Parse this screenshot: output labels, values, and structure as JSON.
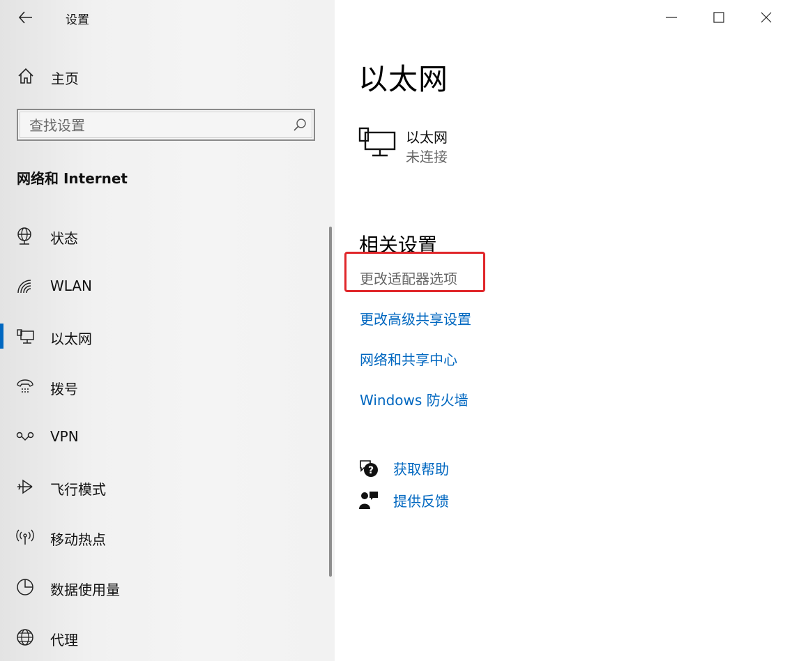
{
  "window": {
    "title": "设置",
    "controls": {
      "minimize": "minimize-icon",
      "maximize": "maximize-icon",
      "close": "close-icon"
    }
  },
  "sidebar": {
    "home_label": "主页",
    "search": {
      "placeholder": "查找设置"
    },
    "section_title": "网络和 Internet",
    "items": [
      {
        "label": "状态",
        "icon": "globe-status-icon"
      },
      {
        "label": "WLAN",
        "icon": "wifi-icon"
      },
      {
        "label": "以太网",
        "icon": "ethernet-icon",
        "selected": true
      },
      {
        "label": "拨号",
        "icon": "dialup-icon"
      },
      {
        "label": "VPN",
        "icon": "vpn-icon"
      },
      {
        "label": "飞行模式",
        "icon": "airplane-icon"
      },
      {
        "label": "移动热点",
        "icon": "hotspot-icon"
      },
      {
        "label": "数据使用量",
        "icon": "data-usage-icon"
      },
      {
        "label": "代理",
        "icon": "globe-proxy-icon"
      }
    ]
  },
  "main": {
    "title": "以太网",
    "device": {
      "name": "以太网",
      "status": "未连接"
    },
    "related": {
      "title": "相关设置",
      "links": [
        {
          "label": "更改适配器选项",
          "highlighted": true
        },
        {
          "label": "更改高级共享设置"
        },
        {
          "label": "网络和共享中心"
        },
        {
          "label": "Windows 防火墙"
        }
      ]
    },
    "help": {
      "get_help": "获取帮助",
      "feedback": "提供反馈"
    }
  },
  "colors": {
    "accent": "#0067c0",
    "highlight_box": "#e0262a"
  }
}
